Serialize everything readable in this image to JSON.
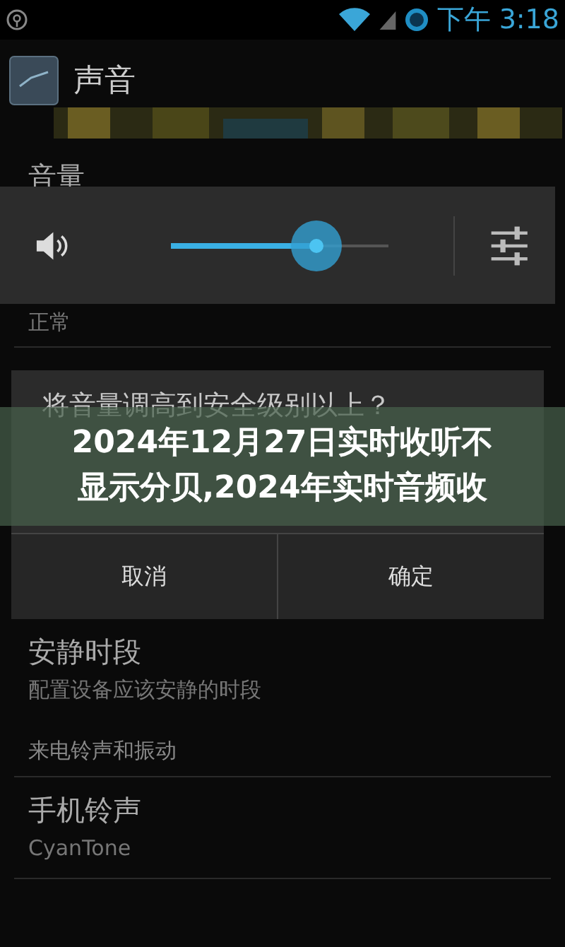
{
  "status_bar": {
    "time": "下午 3:18"
  },
  "action_bar": {
    "title": "声音"
  },
  "volume_header": "音量",
  "volume_panel": {
    "level": 0.67
  },
  "volume_summary": "正常",
  "dialog": {
    "message": "将音量调高到安全级别以上？",
    "buttons": [
      "取消",
      "确定"
    ]
  },
  "banner": {
    "title": "2024年12月27日实时收听不显示分贝,2024年实时音频收"
  },
  "items": [
    {
      "kind": "pref",
      "title": "安静时段",
      "summary": "配置设备应该安静的时段"
    },
    {
      "kind": "category",
      "title": "来电铃声和振动"
    },
    {
      "kind": "pref",
      "title": "手机铃声",
      "summary": "CyanTone"
    }
  ]
}
